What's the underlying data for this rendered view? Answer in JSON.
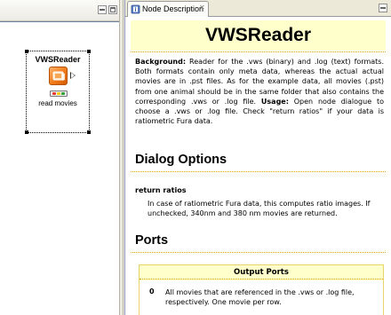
{
  "left_editor": {
    "node": {
      "title": "VWSReader",
      "label": "read movies",
      "icon": "reader-node-icon",
      "icon_color": "#f07a1a"
    }
  },
  "right_view": {
    "tab": {
      "title": "Node Description",
      "close_glyph": "✕",
      "icon": "info-book-icon"
    },
    "content": {
      "title": "VWSReader",
      "background_label": "Background:",
      "background_text_1": " Reader for the .vws (binary) and .log (text) formats. Both formats contain only meta data, whereas the actual actual movies are in .pst files. As for the example data, all movies (.pst) from one animal should be in the same folder that also contains the corresponding .vws or .log file. ",
      "usage_label": "Usage:",
      "usage_text": " Open node dialogue to choose a .vws or .log file. Check \"return ratios\" if your data is ratiometric Fura data.",
      "dialog_heading": "Dialog Options",
      "option_name": "return ratios",
      "option_desc": "In case of ratiometric Fura data, this computes ratio images. If unchecked, 340nm and 380 nm movies are returned.",
      "ports_heading": "Ports",
      "output_ports_header": "Output Ports",
      "port_index": "0",
      "port_desc": "All movies that are referenced in the .vws or .log file, respectively. One movie per row."
    }
  },
  "colors": {
    "title_bg": "#ffffcc",
    "dotted_rule": "#d9a200",
    "status_red": "#e53b2d",
    "status_yellow": "#f5c800",
    "status_green": "#2fa23a"
  }
}
